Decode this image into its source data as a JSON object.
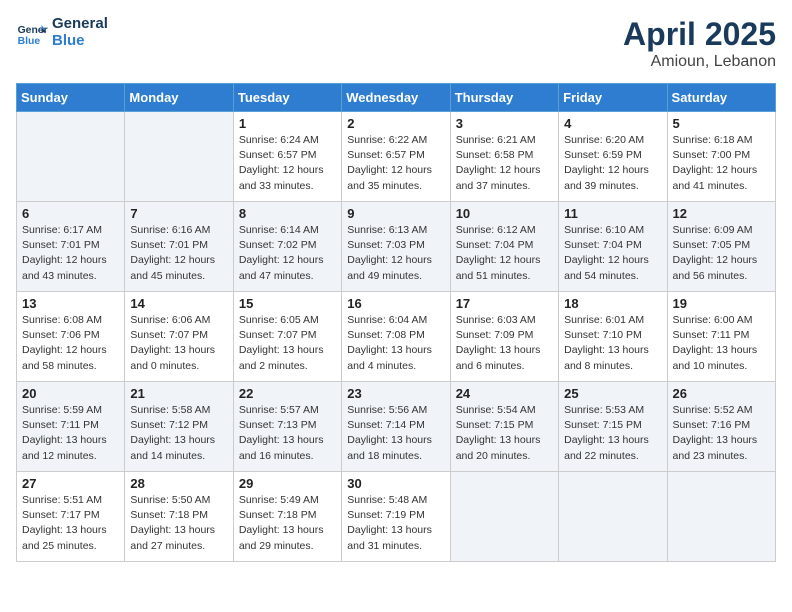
{
  "header": {
    "logo_line1": "General",
    "logo_line2": "Blue",
    "title": "April 2025",
    "subtitle": "Amioun, Lebanon"
  },
  "days_of_week": [
    "Sunday",
    "Monday",
    "Tuesday",
    "Wednesday",
    "Thursday",
    "Friday",
    "Saturday"
  ],
  "weeks": [
    [
      {
        "day": "",
        "info": ""
      },
      {
        "day": "",
        "info": ""
      },
      {
        "day": "1",
        "info": "Sunrise: 6:24 AM\nSunset: 6:57 PM\nDaylight: 12 hours and 33 minutes."
      },
      {
        "day": "2",
        "info": "Sunrise: 6:22 AM\nSunset: 6:57 PM\nDaylight: 12 hours and 35 minutes."
      },
      {
        "day": "3",
        "info": "Sunrise: 6:21 AM\nSunset: 6:58 PM\nDaylight: 12 hours and 37 minutes."
      },
      {
        "day": "4",
        "info": "Sunrise: 6:20 AM\nSunset: 6:59 PM\nDaylight: 12 hours and 39 minutes."
      },
      {
        "day": "5",
        "info": "Sunrise: 6:18 AM\nSunset: 7:00 PM\nDaylight: 12 hours and 41 minutes."
      }
    ],
    [
      {
        "day": "6",
        "info": "Sunrise: 6:17 AM\nSunset: 7:01 PM\nDaylight: 12 hours and 43 minutes."
      },
      {
        "day": "7",
        "info": "Sunrise: 6:16 AM\nSunset: 7:01 PM\nDaylight: 12 hours and 45 minutes."
      },
      {
        "day": "8",
        "info": "Sunrise: 6:14 AM\nSunset: 7:02 PM\nDaylight: 12 hours and 47 minutes."
      },
      {
        "day": "9",
        "info": "Sunrise: 6:13 AM\nSunset: 7:03 PM\nDaylight: 12 hours and 49 minutes."
      },
      {
        "day": "10",
        "info": "Sunrise: 6:12 AM\nSunset: 7:04 PM\nDaylight: 12 hours and 51 minutes."
      },
      {
        "day": "11",
        "info": "Sunrise: 6:10 AM\nSunset: 7:04 PM\nDaylight: 12 hours and 54 minutes."
      },
      {
        "day": "12",
        "info": "Sunrise: 6:09 AM\nSunset: 7:05 PM\nDaylight: 12 hours and 56 minutes."
      }
    ],
    [
      {
        "day": "13",
        "info": "Sunrise: 6:08 AM\nSunset: 7:06 PM\nDaylight: 12 hours and 58 minutes."
      },
      {
        "day": "14",
        "info": "Sunrise: 6:06 AM\nSunset: 7:07 PM\nDaylight: 13 hours and 0 minutes."
      },
      {
        "day": "15",
        "info": "Sunrise: 6:05 AM\nSunset: 7:07 PM\nDaylight: 13 hours and 2 minutes."
      },
      {
        "day": "16",
        "info": "Sunrise: 6:04 AM\nSunset: 7:08 PM\nDaylight: 13 hours and 4 minutes."
      },
      {
        "day": "17",
        "info": "Sunrise: 6:03 AM\nSunset: 7:09 PM\nDaylight: 13 hours and 6 minutes."
      },
      {
        "day": "18",
        "info": "Sunrise: 6:01 AM\nSunset: 7:10 PM\nDaylight: 13 hours and 8 minutes."
      },
      {
        "day": "19",
        "info": "Sunrise: 6:00 AM\nSunset: 7:11 PM\nDaylight: 13 hours and 10 minutes."
      }
    ],
    [
      {
        "day": "20",
        "info": "Sunrise: 5:59 AM\nSunset: 7:11 PM\nDaylight: 13 hours and 12 minutes."
      },
      {
        "day": "21",
        "info": "Sunrise: 5:58 AM\nSunset: 7:12 PM\nDaylight: 13 hours and 14 minutes."
      },
      {
        "day": "22",
        "info": "Sunrise: 5:57 AM\nSunset: 7:13 PM\nDaylight: 13 hours and 16 minutes."
      },
      {
        "day": "23",
        "info": "Sunrise: 5:56 AM\nSunset: 7:14 PM\nDaylight: 13 hours and 18 minutes."
      },
      {
        "day": "24",
        "info": "Sunrise: 5:54 AM\nSunset: 7:15 PM\nDaylight: 13 hours and 20 minutes."
      },
      {
        "day": "25",
        "info": "Sunrise: 5:53 AM\nSunset: 7:15 PM\nDaylight: 13 hours and 22 minutes."
      },
      {
        "day": "26",
        "info": "Sunrise: 5:52 AM\nSunset: 7:16 PM\nDaylight: 13 hours and 23 minutes."
      }
    ],
    [
      {
        "day": "27",
        "info": "Sunrise: 5:51 AM\nSunset: 7:17 PM\nDaylight: 13 hours and 25 minutes."
      },
      {
        "day": "28",
        "info": "Sunrise: 5:50 AM\nSunset: 7:18 PM\nDaylight: 13 hours and 27 minutes."
      },
      {
        "day": "29",
        "info": "Sunrise: 5:49 AM\nSunset: 7:18 PM\nDaylight: 13 hours and 29 minutes."
      },
      {
        "day": "30",
        "info": "Sunrise: 5:48 AM\nSunset: 7:19 PM\nDaylight: 13 hours and 31 minutes."
      },
      {
        "day": "",
        "info": ""
      },
      {
        "day": "",
        "info": ""
      },
      {
        "day": "",
        "info": ""
      }
    ]
  ]
}
